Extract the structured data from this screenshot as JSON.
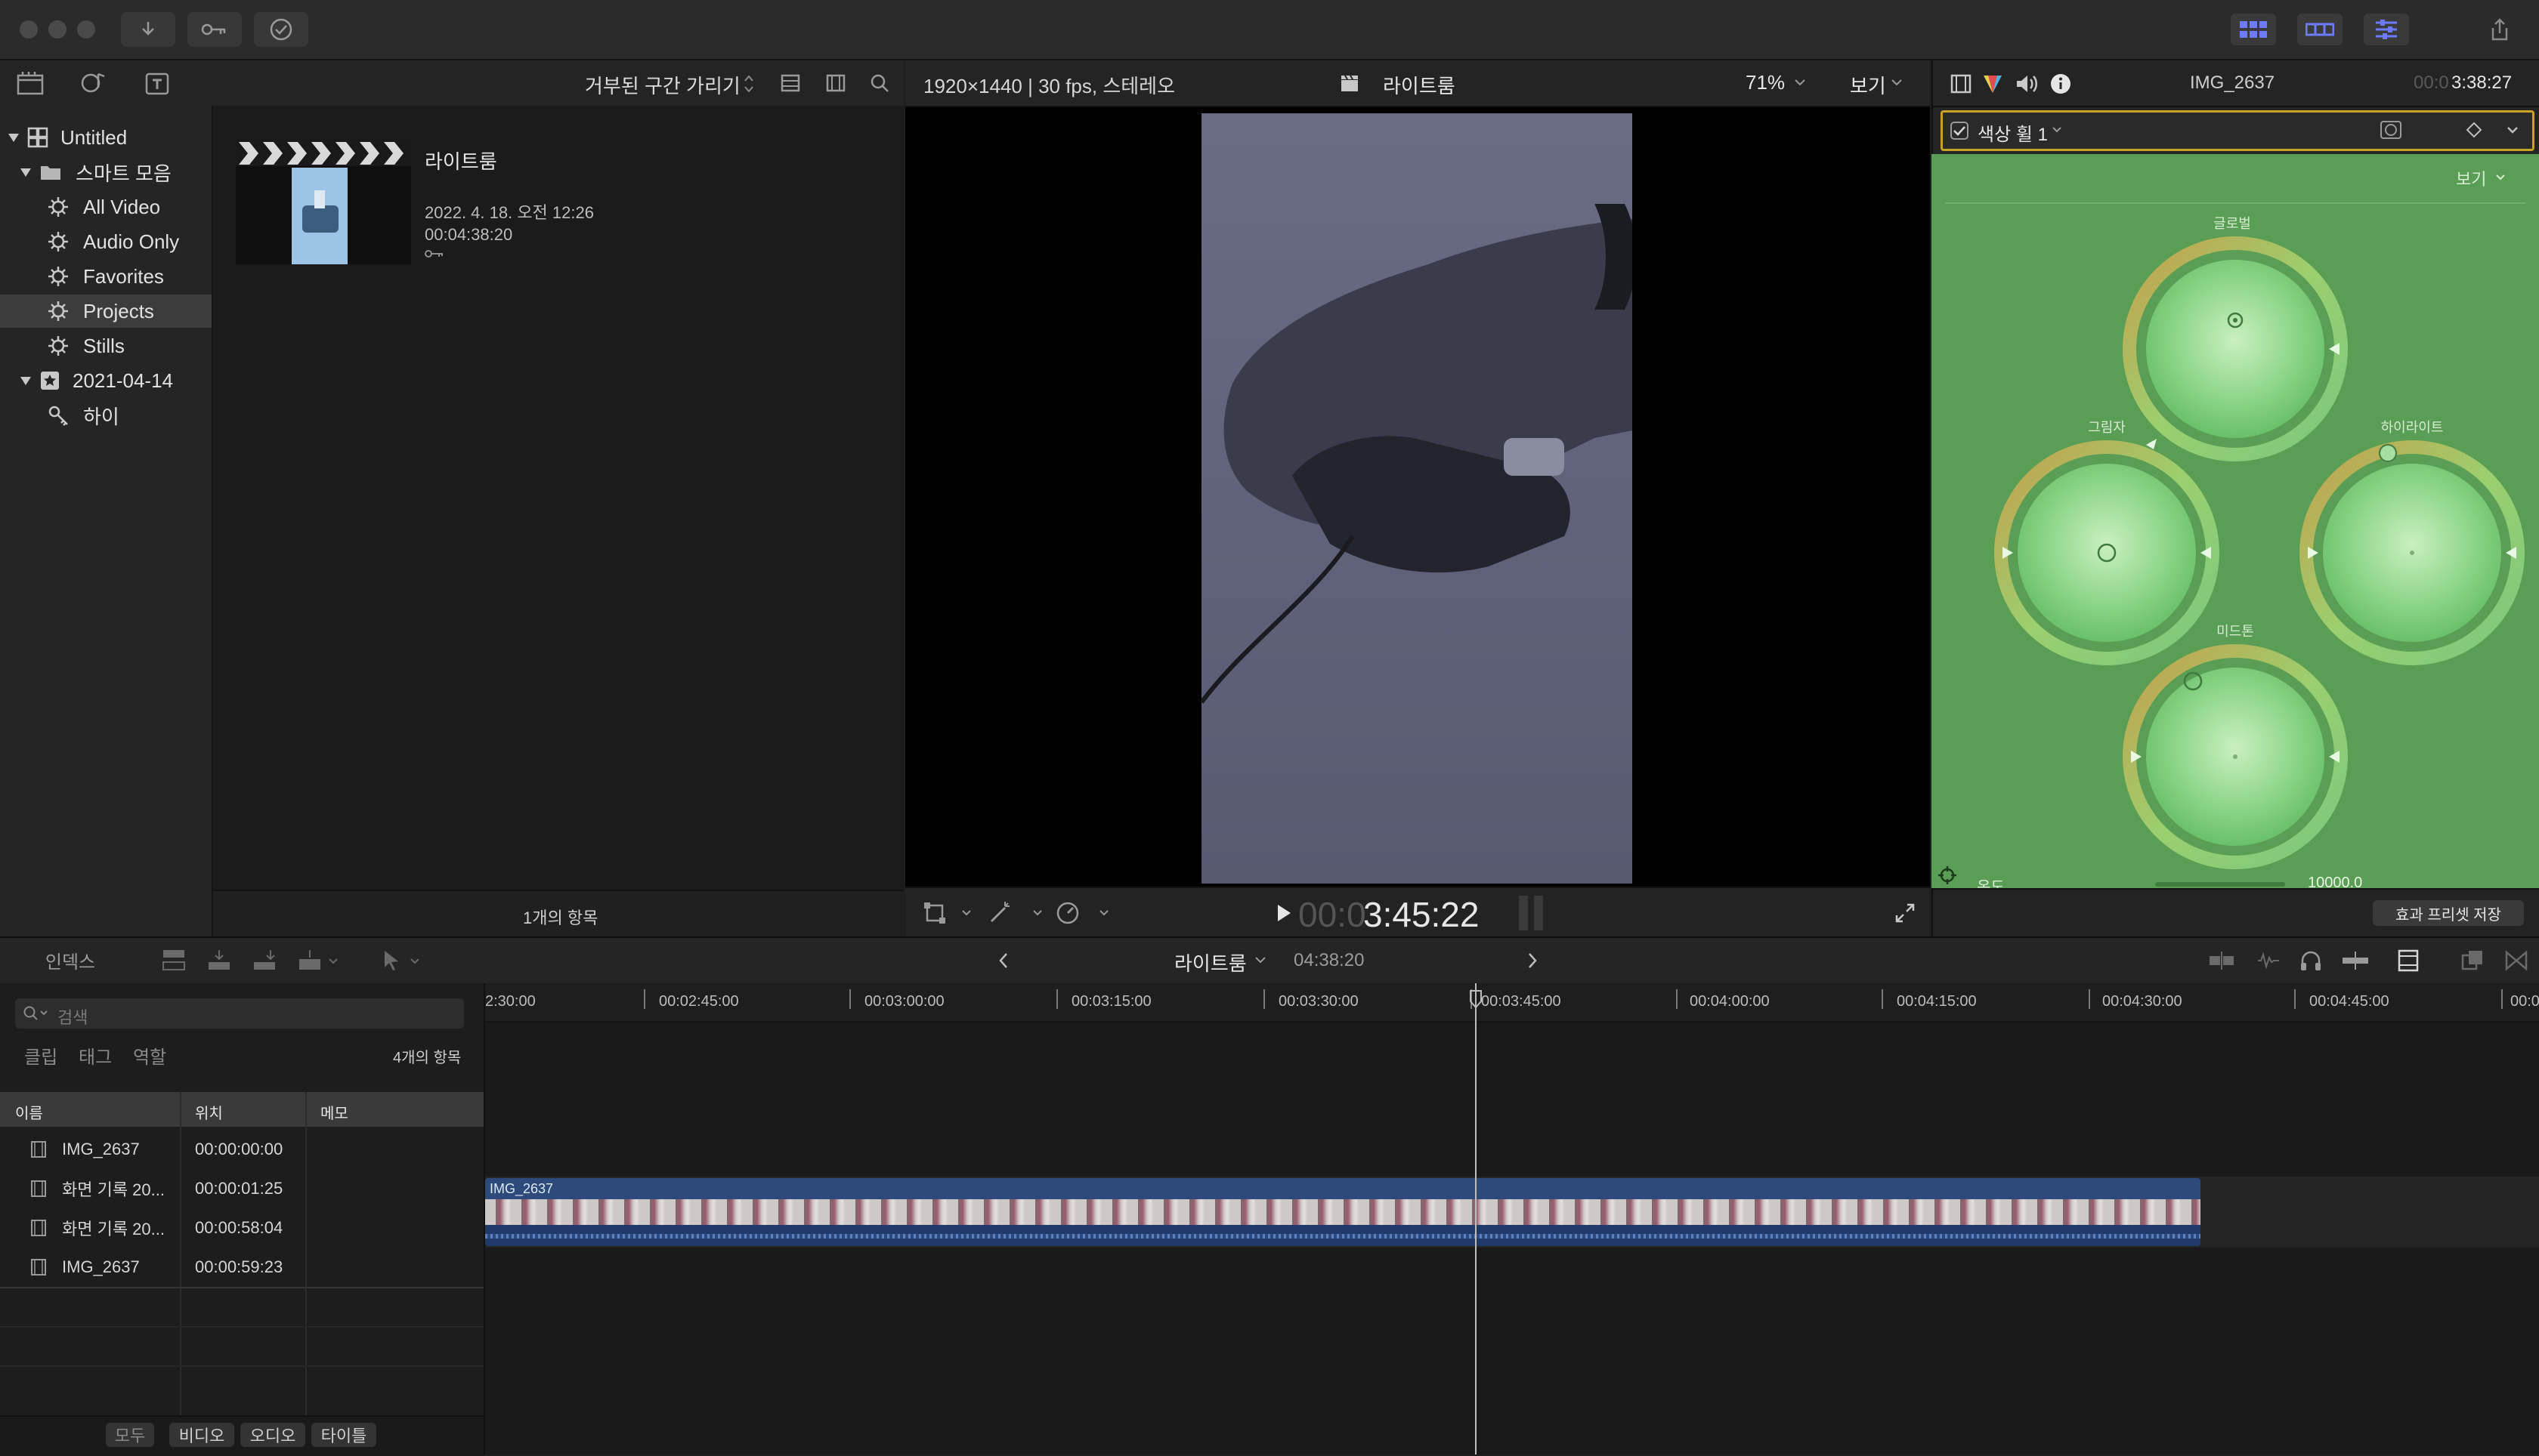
{
  "window": {
    "toolbar_icons": [
      "import-icon",
      "key-icon",
      "checkmark-icon"
    ],
    "right_icons": [
      "library-grid-icon",
      "browser-filmstrip-icon",
      "inspector-sliders-icon",
      "share-icon"
    ]
  },
  "library": {
    "items": [
      {
        "label": "Untitled",
        "icon": "library-icon",
        "level": 0,
        "disclosure": true
      },
      {
        "label": "스마트 모음",
        "icon": "folder-icon",
        "level": 1,
        "disclosure": true
      },
      {
        "label": "All Video",
        "icon": "gear-icon",
        "level": 2
      },
      {
        "label": "Audio Only",
        "icon": "gear-icon",
        "level": 2
      },
      {
        "label": "Favorites",
        "icon": "gear-icon",
        "level": 2
      },
      {
        "label": "Projects",
        "icon": "gear-icon",
        "level": 2,
        "selected": true
      },
      {
        "label": "Stills",
        "icon": "gear-icon",
        "level": 2
      },
      {
        "label": "2021-04-14",
        "icon": "event-star-icon",
        "level": 1,
        "disclosure": true
      },
      {
        "label": "하이",
        "icon": "keyword-icon",
        "level": 2
      }
    ]
  },
  "browser": {
    "filter_label": "거부된 구간 가리기",
    "project": {
      "name": "라이트룸",
      "date": "2022. 4. 18. 오전 12:26",
      "duration": "00:04:38:20"
    },
    "item_count": "1개의 항목"
  },
  "viewer": {
    "format": "1920×1440 | 30 fps, 스테레오",
    "project_name": "라이트룸",
    "zoom": "71%",
    "view_menu": "보기",
    "timecode_dim": "00:0",
    "timecode": "3:45:22"
  },
  "inspector": {
    "clip_name": "IMG_2637",
    "timecode_dim": "00:0",
    "timecode": "3:38:27",
    "effect_name": "색상 휠 1",
    "view_menu": "보기",
    "wheels": {
      "global": "글로벌",
      "shadows": "그림자",
      "highlights": "하이라이트",
      "midtones": "미드톤"
    },
    "temperature_label": "온도",
    "temperature_value": "10000.0",
    "save_preset": "효과 프리셋 저장"
  },
  "timeline_header": {
    "index_label": "인덱스",
    "project_name": "라이트룸",
    "duration": "04:38:20"
  },
  "index": {
    "search_placeholder": "검색",
    "tabs": [
      "클립",
      "태그",
      "역할"
    ],
    "count": "4개의 항목",
    "columns": [
      "이름",
      "위치",
      "메모"
    ],
    "rows": [
      {
        "name": "IMG_2637",
        "position": "00:00:00:00"
      },
      {
        "name": "화면 기록 20...",
        "position": "00:00:01:25"
      },
      {
        "name": "화면 기록 20...",
        "position": "00:00:58:04"
      },
      {
        "name": "IMG_2637",
        "position": "00:00:59:23"
      }
    ],
    "filters": [
      "모두",
      "비디오",
      "오디오",
      "타이틀"
    ]
  },
  "timeline": {
    "ruler": [
      "2:30:00",
      "00:02:45:00",
      "00:03:00:00",
      "00:03:15:00",
      "00:03:30:00",
      "00:03:45:00",
      "00:04:00:00",
      "00:04:15:00",
      "00:04:30:00",
      "00:04:45:00",
      "00:0"
    ],
    "clip_name": "IMG_2637"
  }
}
